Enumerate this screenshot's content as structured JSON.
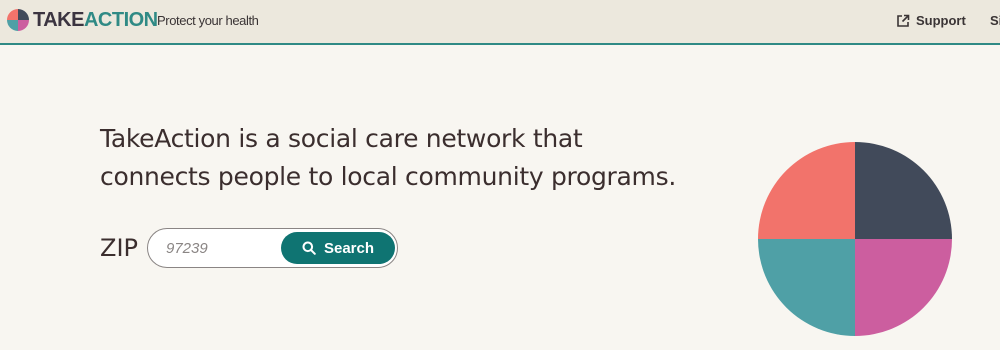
{
  "header": {
    "brand_take": "TAKE",
    "brand_action": "ACTION",
    "tagline": "Protect your health",
    "support_label": "Support",
    "sign_label": "Sig",
    "logo_colors": {
      "top_left": "#f2736b",
      "top_right": "#414a5a",
      "bottom_left": "#4fa0a6",
      "bottom_right": "#cc5e9f"
    }
  },
  "hero": {
    "line1": "TakeAction is a social care network that",
    "line2": "connects people to local community programs."
  },
  "search": {
    "zip_label": "ZIP",
    "zip_placeholder": "97239",
    "button_label": "Search",
    "button_color": "#0f7472"
  },
  "illustration": {
    "quadrants": {
      "top_left": "#f2736b",
      "top_right": "#414a5a",
      "bottom_left": "#4fa0a6",
      "bottom_right": "#cc5e9f"
    }
  },
  "colors": {
    "header_bg": "#ece8dd",
    "page_bg": "#f8f6f1",
    "accent_teal": "#2f8a85"
  },
  "icons": {
    "external_link": "external-link-icon",
    "search": "search-icon"
  }
}
